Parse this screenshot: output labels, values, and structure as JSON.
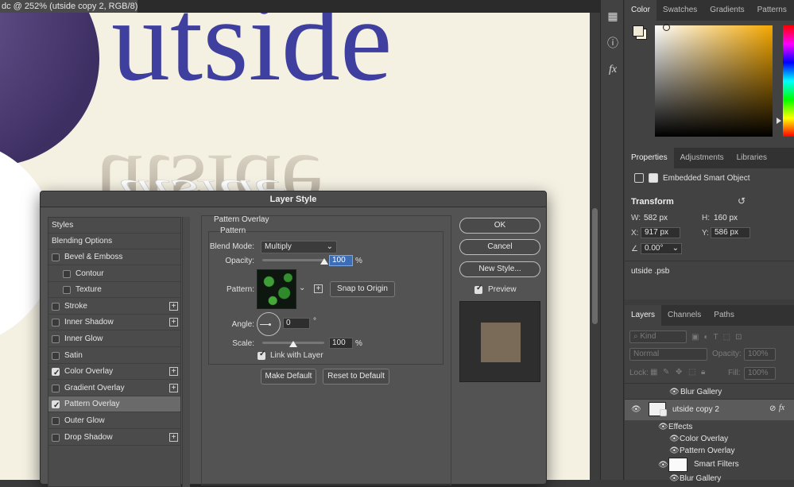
{
  "document": {
    "tab_title": "dc @ 252% (utside  copy 2, RGB/8) *",
    "canvas_word": "utside",
    "canvas_word_reflected": "utside"
  },
  "tool_column": {
    "icons": [
      "pattern-icon",
      "info-icon",
      "fx-icon"
    ]
  },
  "color_panel": {
    "tabs": [
      "Color",
      "Swatches",
      "Gradients",
      "Patterns"
    ],
    "active_tab": "Color",
    "foreground_color": "#f1ead6",
    "background_color": "#fbf6e4",
    "field_hue_color": "#f5a800"
  },
  "properties_panel": {
    "tabs": [
      "Properties",
      "Adjustments",
      "Libraries"
    ],
    "active_tab": "Properties",
    "object_type": "Embedded Smart Object",
    "section_title": "Transform",
    "w_label": "W:",
    "w_value": "582 px",
    "h_label": "H:",
    "h_value": "160 px",
    "x_label": "X:",
    "x_value": "917 px",
    "y_label": "Y:",
    "y_value": "586 px",
    "angle_value": "0.00°",
    "source_file": "utside .psb"
  },
  "layers_panel": {
    "tabs": [
      "Layers",
      "Channels",
      "Paths"
    ],
    "active_tab": "Layers",
    "filter_kind": "Kind",
    "blend_mode": "Normal",
    "opacity_label": "Opacity:",
    "opacity_value": "100%",
    "lock_label": "Lock:",
    "fill_label": "Fill:",
    "fill_value": "100%",
    "rows": {
      "blur_gallery_top": "Blur Gallery",
      "layer_name": "utside  copy 2",
      "effects": "Effects",
      "effect_color_overlay": "Color Overlay",
      "effect_pattern_overlay": "Pattern Overlay",
      "smart_filters": "Smart Filters",
      "blur_gallery_bottom": "Blur Gallery"
    },
    "fx_label": "fx"
  },
  "dialog": {
    "title": "Layer Style",
    "styles_header": "Styles",
    "blending_options": "Blending Options",
    "styles": [
      {
        "label": "Bevel & Emboss",
        "checked": false,
        "plus": false
      },
      {
        "label": "Contour",
        "checked": false,
        "plus": false
      },
      {
        "label": "Texture",
        "checked": false,
        "plus": false
      },
      {
        "label": "Stroke",
        "checked": false,
        "plus": true
      },
      {
        "label": "Inner Shadow",
        "checked": false,
        "plus": true
      },
      {
        "label": "Inner Glow",
        "checked": false,
        "plus": false
      },
      {
        "label": "Satin",
        "checked": false,
        "plus": false
      },
      {
        "label": "Color Overlay",
        "checked": true,
        "plus": true
      },
      {
        "label": "Gradient Overlay",
        "checked": false,
        "plus": true
      },
      {
        "label": "Pattern Overlay",
        "checked": true,
        "plus": false
      },
      {
        "label": "Outer Glow",
        "checked": false,
        "plus": false
      },
      {
        "label": "Drop Shadow",
        "checked": false,
        "plus": true
      }
    ],
    "active_style": "Pattern Overlay",
    "section_title": "Pattern Overlay",
    "group_title": "Pattern",
    "blend_mode_label": "Blend Mode:",
    "blend_mode_value": "Multiply",
    "opacity_label": "Opacity:",
    "opacity_value": "100",
    "opacity_unit": "%",
    "opacity_level": 1.0,
    "pattern_label": "Pattern:",
    "snap_button": "Snap to Origin",
    "angle_label": "Angle:",
    "angle_value": "0",
    "angle_unit": "°",
    "scale_label": "Scale:",
    "scale_value": "100",
    "scale_unit": "%",
    "scale_level": 0.5,
    "link_label": "Link with Layer",
    "link_checked": true,
    "make_default": "Make Default",
    "reset_default": "Reset to Default",
    "ok": "OK",
    "cancel": "Cancel",
    "new_style": "New Style...",
    "preview_label": "Preview",
    "preview_checked": true,
    "preview_color": "#7a6a58"
  }
}
